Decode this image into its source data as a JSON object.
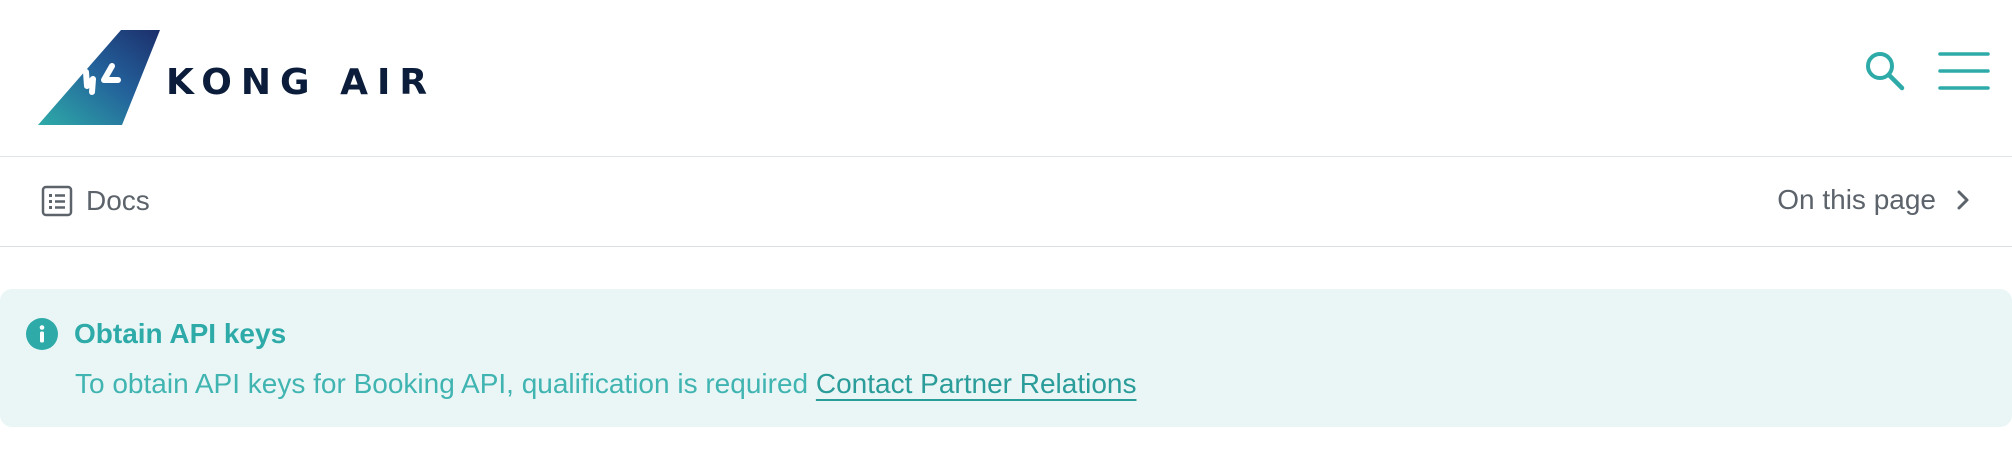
{
  "header": {
    "logo_text": "KONG AIR",
    "logo_alt": "Kong Air",
    "search_icon": "search-icon",
    "menu_icon": "hamburger-menu-icon"
  },
  "subnav": {
    "docs_label": "Docs",
    "docs_icon": "list-document-icon",
    "on_this_page_label": "On this page",
    "chevron_icon": "chevron-right-icon"
  },
  "callout": {
    "icon": "info-icon",
    "title": "Obtain API keys",
    "body_text": "To obtain API keys for Booking API, qualification is required",
    "link_text": "Contact Partner Relations"
  },
  "colors": {
    "brand_navy": "#1c2f6b",
    "brand_teal": "#2eaba8",
    "logo_text": "#0b1d3a",
    "callout_bg": "#eaf6f6",
    "muted_text": "#5c636b"
  }
}
